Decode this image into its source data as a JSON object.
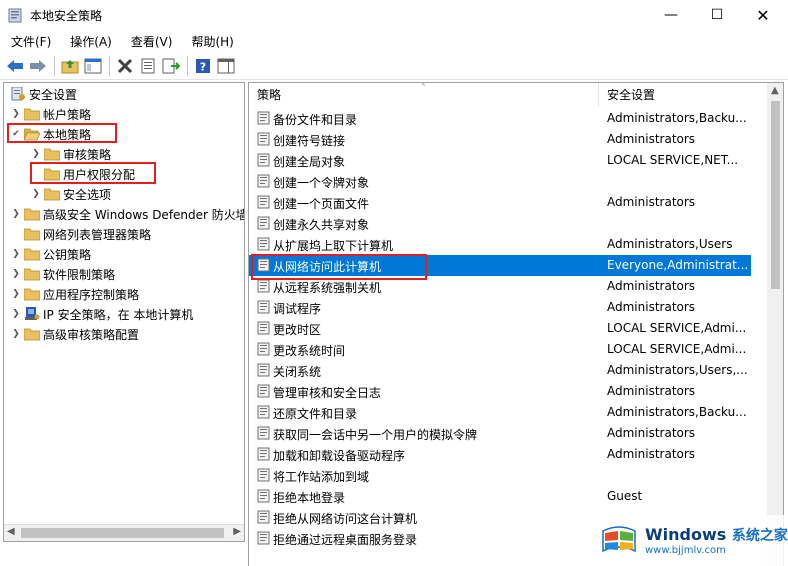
{
  "window": {
    "title": "本地安全策略",
    "minimize_glyph": "—",
    "maximize_glyph": "☐",
    "close_glyph": "✕"
  },
  "menu": [
    "文件(F)",
    "操作(A)",
    "查看(V)",
    "帮助(H)"
  ],
  "tree": {
    "root": "安全设置",
    "items": [
      {
        "label": "帐户策略",
        "level": 1,
        "expanded": false
      },
      {
        "label": "本地策略",
        "level": 1,
        "expanded": true
      },
      {
        "label": "审核策略",
        "level": 2,
        "expanded": false
      },
      {
        "label": "用户权限分配",
        "level": 2,
        "expanded": false
      },
      {
        "label": "安全选项",
        "level": 2,
        "expanded": false
      },
      {
        "label": "高级安全 Windows Defender 防火墙",
        "level": 1,
        "expanded": false
      },
      {
        "label": "网络列表管理器策略",
        "level": 1,
        "expanded": false
      },
      {
        "label": "公钥策略",
        "level": 1,
        "expanded": false
      },
      {
        "label": "软件限制策略",
        "level": 1,
        "expanded": false
      },
      {
        "label": "应用程序控制策略",
        "level": 1,
        "expanded": false
      },
      {
        "label": "IP 安全策略，在 本地计算机",
        "level": 1,
        "expanded": false
      },
      {
        "label": "高级审核策略配置",
        "level": 1,
        "expanded": false
      }
    ]
  },
  "list": {
    "columns": [
      "策略",
      "安全设置"
    ],
    "rows": [
      {
        "name": "备份文件和目录",
        "value": "Administrators,Backu..."
      },
      {
        "name": "创建符号链接",
        "value": "Administrators"
      },
      {
        "name": "创建全局对象",
        "value": "LOCAL SERVICE,NET..."
      },
      {
        "name": "创建一个令牌对象",
        "value": ""
      },
      {
        "name": "创建一个页面文件",
        "value": "Administrators"
      },
      {
        "name": "创建永久共享对象",
        "value": ""
      },
      {
        "name": "从扩展坞上取下计算机",
        "value": "Administrators,Users"
      },
      {
        "name": "从网络访问此计算机",
        "value": "Everyone,Administrat...",
        "selected": true
      },
      {
        "name": "从远程系统强制关机",
        "value": "Administrators"
      },
      {
        "name": "调试程序",
        "value": "Administrators"
      },
      {
        "name": "更改时区",
        "value": "LOCAL SERVICE,Admi..."
      },
      {
        "name": "更改系统时间",
        "value": "LOCAL SERVICE,Admi..."
      },
      {
        "name": "关闭系统",
        "value": "Administrators,Users,..."
      },
      {
        "name": "管理审核和安全日志",
        "value": "Administrators"
      },
      {
        "name": "还原文件和目录",
        "value": "Administrators,Backu..."
      },
      {
        "name": "获取同一会话中另一个用户的模拟令牌",
        "value": "Administrators"
      },
      {
        "name": "加载和卸载设备驱动程序",
        "value": "Administrators"
      },
      {
        "name": "将工作站添加到域",
        "value": ""
      },
      {
        "name": "拒绝本地登录",
        "value": "Guest"
      },
      {
        "name": "拒绝从网络访问这台计算机",
        "value": ""
      },
      {
        "name": "拒绝通过远程桌面服务登录",
        "value": ""
      }
    ]
  },
  "watermark": {
    "brand": "Windows",
    "brand_cn": "系统之家",
    "url": "www.bjjmlv.com"
  },
  "colors": {
    "selection": "#0078d7",
    "annotation": "#e02020",
    "folder": "#e8c060"
  }
}
